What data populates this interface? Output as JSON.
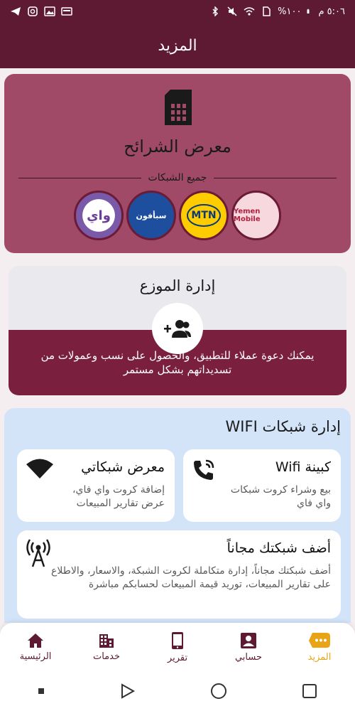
{
  "status_bar": {
    "time": "٥:٠٦ م",
    "battery": "%١٠٠",
    "left_icons": [
      "telegram-icon",
      "instagram-icon",
      "gallery-icon",
      "message-icon"
    ],
    "right_icons": [
      "bluetooth-icon",
      "mute-icon",
      "wifi-icon",
      "sim-icon",
      "battery-icon"
    ]
  },
  "app_bar": {
    "title": "المزيد"
  },
  "sim_gallery": {
    "icon": "sim-card-icon",
    "title": "معرض الشرائح",
    "subtitle": "جميع الشبكات",
    "networks": [
      {
        "name": "wai",
        "logo_text": "واي",
        "color": "#7a5aa8"
      },
      {
        "name": "sabafon",
        "logo_text": "سبأفون",
        "color": "#1d4f9e"
      },
      {
        "name": "mtn",
        "logo_text": "MTN",
        "color": "#ffcc00"
      },
      {
        "name": "yemen-mobile",
        "logo_text": "Yemen Mobile",
        "color": "#b01f3e"
      }
    ]
  },
  "distributor": {
    "title": "إدارة الموزع",
    "icon": "add-users-icon",
    "description": "يمكنك دعوة عملاء للتطبيق، والحصول على نسب وعمولات من تسديداتهم بشكل مستمر"
  },
  "wifi": {
    "title": "إدارة شبكات WIFI",
    "cards": [
      {
        "title": "كبينة Wifi",
        "description": "بيع وشراء كروت شبكات واي فاي",
        "icon": "phone-call-icon"
      },
      {
        "title": "معرض شبكاتي",
        "description": "إضافة كروت واي فاي، عرض تقارير المبيعات",
        "icon": "wifi-signal-icon"
      },
      {
        "title": "أضف شبكتك مجاناً",
        "description": "أضف شبكتك مجاناً، إدارة متكاملة لكروت الشبكة، والاسعار، والاطلاع على تقارير المبيعات، توريد قيمة المبيعات لحسابكم مباشرة",
        "icon": "antenna-icon"
      }
    ]
  },
  "bottom_nav": {
    "items": [
      {
        "label": "الرئيسية",
        "icon": "home-icon"
      },
      {
        "label": "خدمات",
        "icon": "building-icon"
      },
      {
        "label": "تقرير",
        "icon": "phone-report-icon"
      },
      {
        "label": "حسابي",
        "icon": "account-icon"
      },
      {
        "label": "المزيد",
        "icon": "more-icon",
        "active": true
      }
    ],
    "active_color": "#e8a317"
  },
  "colors": {
    "primary": "#5e1a33",
    "sim_card": "#a04a68",
    "wifi_bg": "#d3e3f8"
  }
}
